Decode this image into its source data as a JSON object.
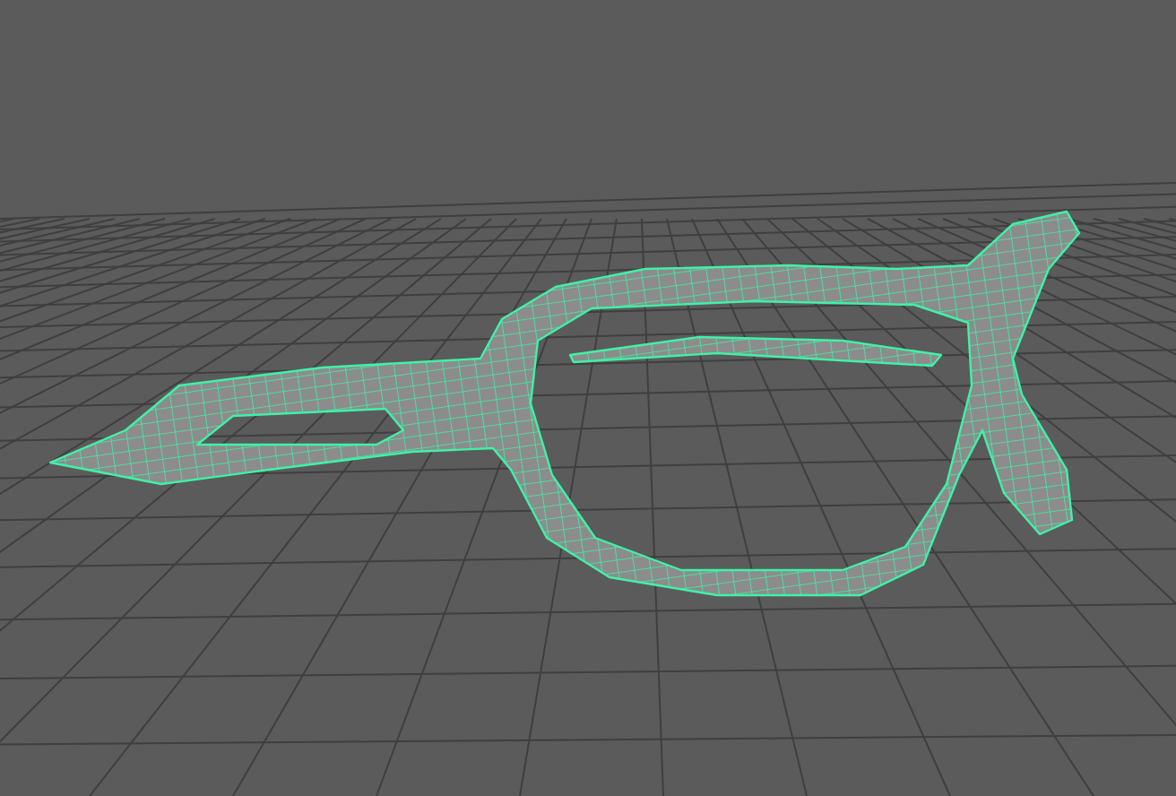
{
  "viewport": {
    "mesh": {
      "selected": true
    }
  }
}
